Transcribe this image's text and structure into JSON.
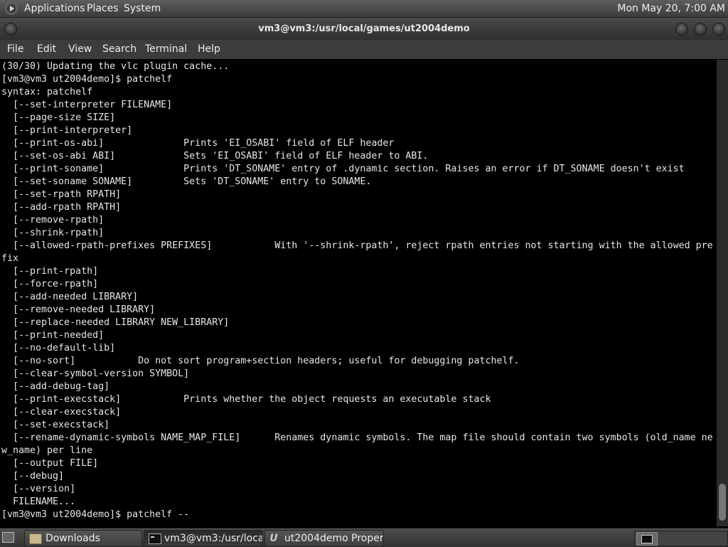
{
  "top_panel": {
    "menus": [
      "Applications",
      "Places",
      "System"
    ],
    "clock": "Mon May 20,  7:00 AM"
  },
  "window": {
    "title": "vm3@vm3:/usr/local/games/ut2004demo"
  },
  "menubar": {
    "items": [
      "File",
      "Edit",
      "View",
      "Search",
      "Terminal",
      "Help"
    ]
  },
  "terminal": {
    "text": "(30/30) Updating the vlc plugin cache...\n[vm3@vm3 ut2004demo]$ patchelf\nsyntax: patchelf\n  [--set-interpreter FILENAME]\n  [--page-size SIZE]\n  [--print-interpreter]\n  [--print-os-abi]              Prints 'EI_OSABI' field of ELF header\n  [--set-os-abi ABI]            Sets 'EI_OSABI' field of ELF header to ABI.\n  [--print-soname]              Prints 'DT_SONAME' entry of .dynamic section. Raises an error if DT_SONAME doesn't exist\n  [--set-soname SONAME]         Sets 'DT_SONAME' entry to SONAME.\n  [--set-rpath RPATH]\n  [--add-rpath RPATH]\n  [--remove-rpath]\n  [--shrink-rpath]\n  [--allowed-rpath-prefixes PREFIXES]           With '--shrink-rpath', reject rpath entries not starting with the allowed pre\nfix\n  [--print-rpath]\n  [--force-rpath]\n  [--add-needed LIBRARY]\n  [--remove-needed LIBRARY]\n  [--replace-needed LIBRARY NEW_LIBRARY]\n  [--print-needed]\n  [--no-default-lib]\n  [--no-sort]           Do not sort program+section headers; useful for debugging patchelf.\n  [--clear-symbol-version SYMBOL]\n  [--add-debug-tag]\n  [--print-execstack]           Prints whether the object requests an executable stack\n  [--clear-execstack]\n  [--set-execstack]\n  [--rename-dynamic-symbols NAME_MAP_FILE]      Renames dynamic symbols. The map file should contain two symbols (old_name ne\nw_name) per line\n  [--output FILE]\n  [--debug]\n  [--version]\n  FILENAME...\n[vm3@vm3 ut2004demo]$ patchelf --"
  },
  "taskbar": {
    "tasks": [
      {
        "label": "Downloads",
        "icon": "folder-icon"
      },
      {
        "label": "vm3@vm3:/usr/loca...",
        "icon": "terminal-icon"
      },
      {
        "label": "ut2004demo Proper...",
        "icon": "ut-icon"
      }
    ]
  },
  "colors": {
    "terminal_bg": "#000000",
    "terminal_fg": "#e6e6e6",
    "panel_bg": "#3c3c3c"
  }
}
